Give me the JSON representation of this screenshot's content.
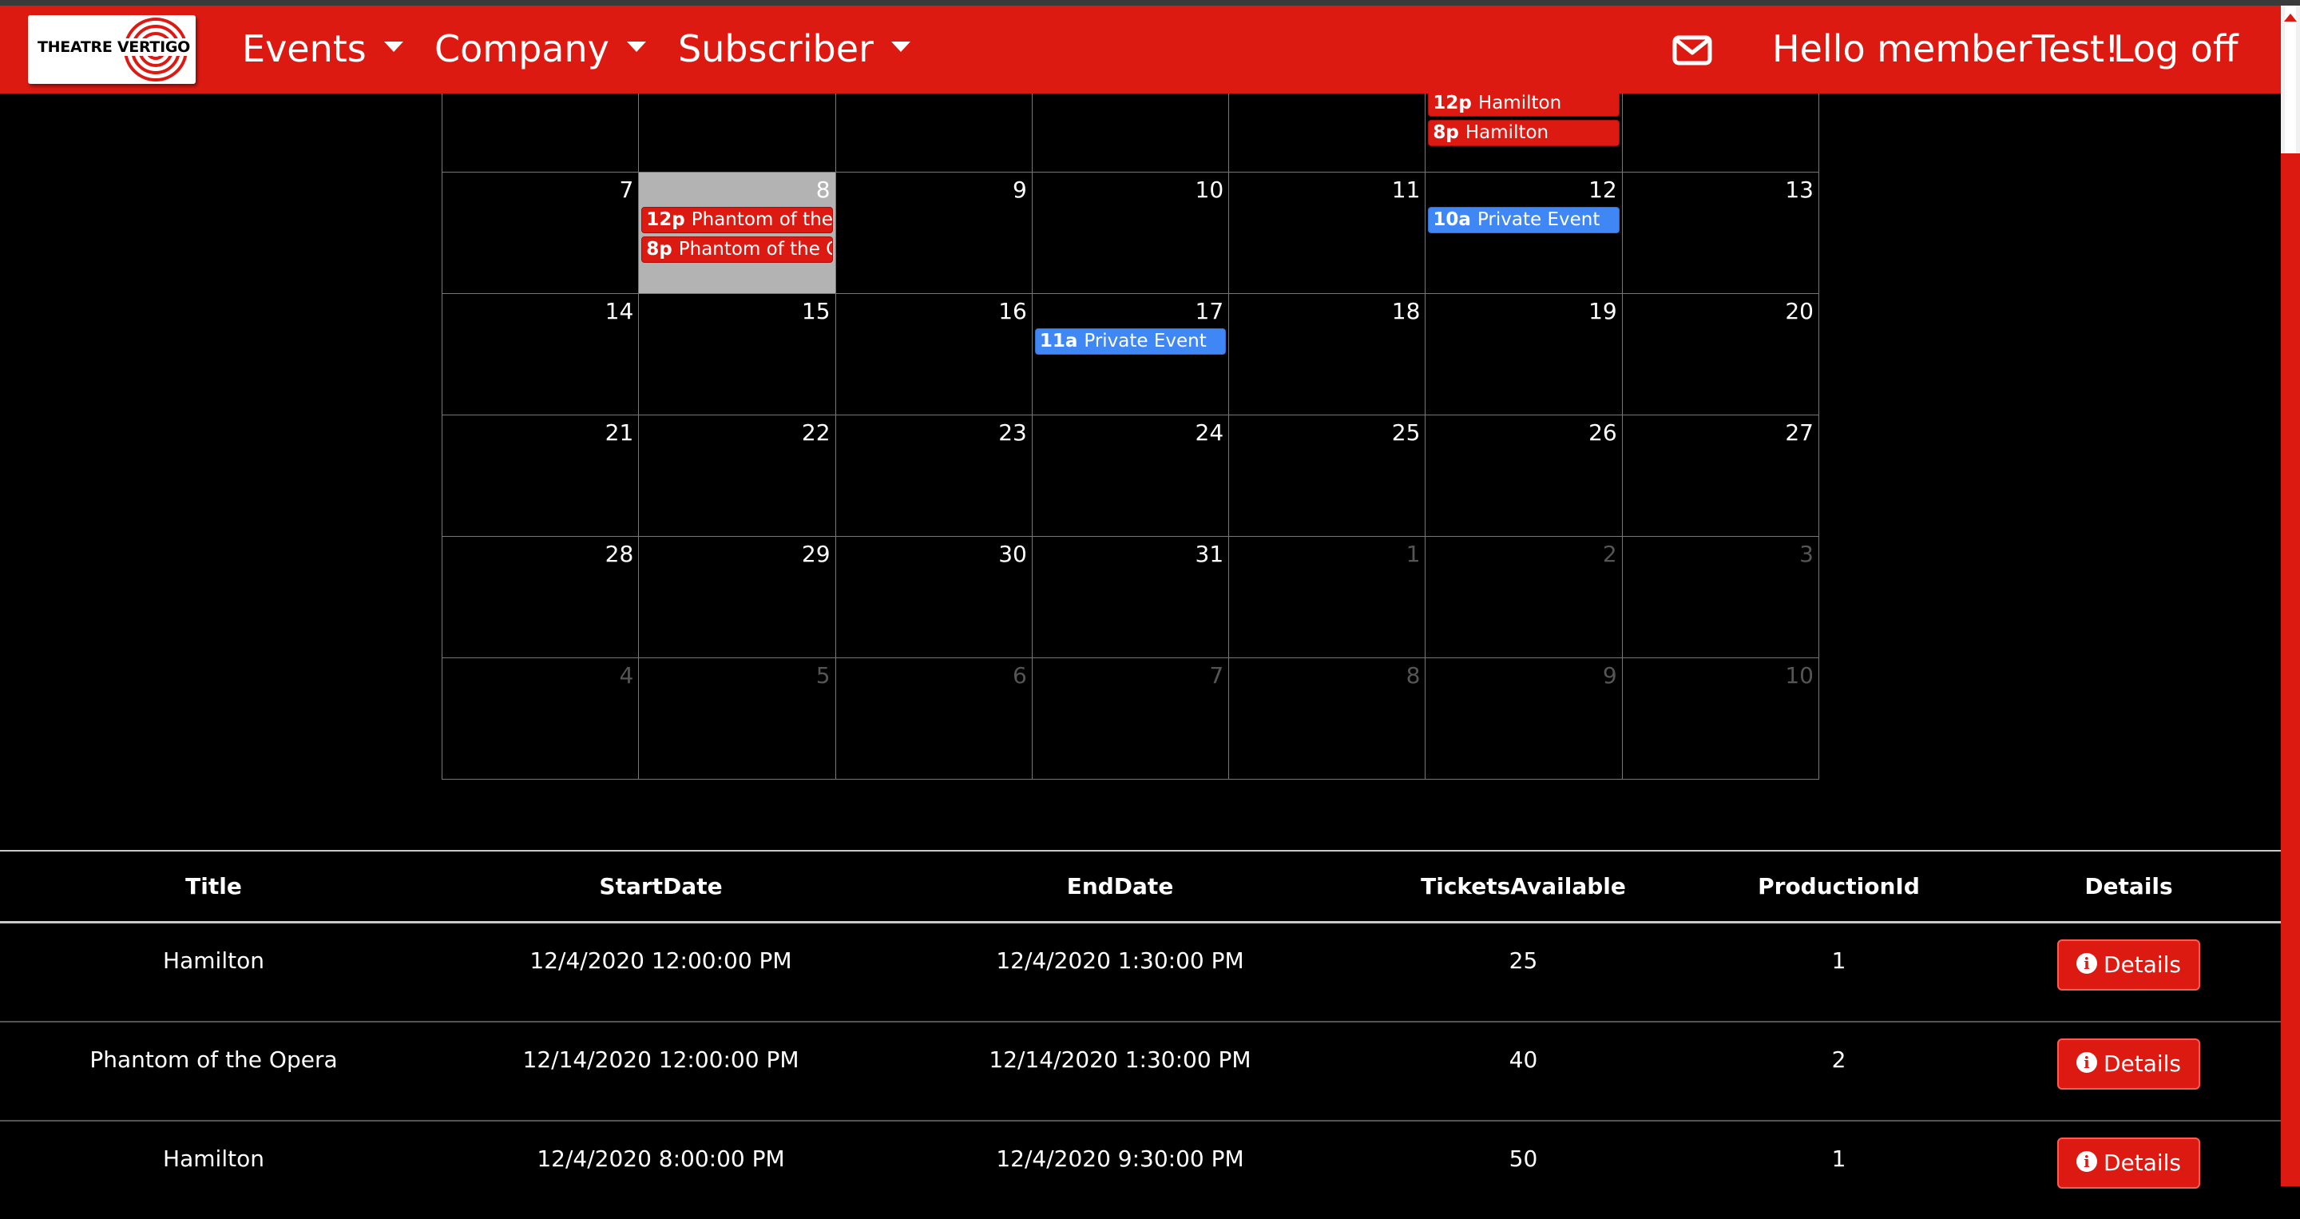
{
  "logo": {
    "text": "THEATRE VERTIGO"
  },
  "nav": {
    "events": "Events",
    "company": "Company",
    "subscriber": "Subscriber",
    "greeting": "Hello memberTest!",
    "logoff": "Log off"
  },
  "calendar": {
    "weeks": [
      [
        {
          "day": "",
          "other": false,
          "today": false,
          "events": []
        },
        {
          "day": "",
          "other": false,
          "today": false,
          "events": []
        },
        {
          "day": "",
          "other": false,
          "today": false,
          "events": []
        },
        {
          "day": "",
          "other": false,
          "today": false,
          "events": []
        },
        {
          "day": "",
          "other": false,
          "today": false,
          "events": []
        },
        {
          "day": "",
          "other": false,
          "today": false,
          "events": [
            {
              "time": "12p",
              "title": "Hamilton",
              "color": "red"
            },
            {
              "time": "8p",
              "title": "Hamilton",
              "color": "red"
            }
          ]
        },
        {
          "day": "",
          "other": false,
          "today": false,
          "events": []
        }
      ],
      [
        {
          "day": "7",
          "other": false,
          "today": false,
          "events": []
        },
        {
          "day": "8",
          "other": false,
          "today": true,
          "events": [
            {
              "time": "12p",
              "title": "Phantom of the Opera",
              "color": "red"
            },
            {
              "time": "8p",
              "title": "Phantom of the Opera",
              "color": "red"
            }
          ]
        },
        {
          "day": "9",
          "other": false,
          "today": false,
          "events": []
        },
        {
          "day": "10",
          "other": false,
          "today": false,
          "events": []
        },
        {
          "day": "11",
          "other": false,
          "today": false,
          "events": []
        },
        {
          "day": "12",
          "other": false,
          "today": false,
          "events": [
            {
              "time": "10a",
              "title": "Private Event",
              "color": "blue"
            }
          ]
        },
        {
          "day": "13",
          "other": false,
          "today": false,
          "events": []
        }
      ],
      [
        {
          "day": "14",
          "other": false,
          "today": false,
          "events": []
        },
        {
          "day": "15",
          "other": false,
          "today": false,
          "events": []
        },
        {
          "day": "16",
          "other": false,
          "today": false,
          "events": []
        },
        {
          "day": "17",
          "other": false,
          "today": false,
          "events": [
            {
              "time": "11a",
              "title": "Private Event",
              "color": "blue"
            }
          ]
        },
        {
          "day": "18",
          "other": false,
          "today": false,
          "events": []
        },
        {
          "day": "19",
          "other": false,
          "today": false,
          "events": []
        },
        {
          "day": "20",
          "other": false,
          "today": false,
          "events": []
        }
      ],
      [
        {
          "day": "21",
          "other": false,
          "today": false,
          "events": []
        },
        {
          "day": "22",
          "other": false,
          "today": false,
          "events": []
        },
        {
          "day": "23",
          "other": false,
          "today": false,
          "events": []
        },
        {
          "day": "24",
          "other": false,
          "today": false,
          "events": []
        },
        {
          "day": "25",
          "other": false,
          "today": false,
          "events": []
        },
        {
          "day": "26",
          "other": false,
          "today": false,
          "events": []
        },
        {
          "day": "27",
          "other": false,
          "today": false,
          "events": []
        }
      ],
      [
        {
          "day": "28",
          "other": false,
          "today": false,
          "events": []
        },
        {
          "day": "29",
          "other": false,
          "today": false,
          "events": []
        },
        {
          "day": "30",
          "other": false,
          "today": false,
          "events": []
        },
        {
          "day": "31",
          "other": false,
          "today": false,
          "events": []
        },
        {
          "day": "1",
          "other": true,
          "today": false,
          "events": []
        },
        {
          "day": "2",
          "other": true,
          "today": false,
          "events": []
        },
        {
          "day": "3",
          "other": true,
          "today": false,
          "events": []
        }
      ],
      [
        {
          "day": "4",
          "other": true,
          "today": false,
          "events": []
        },
        {
          "day": "5",
          "other": true,
          "today": false,
          "events": []
        },
        {
          "day": "6",
          "other": true,
          "today": false,
          "events": []
        },
        {
          "day": "7",
          "other": true,
          "today": false,
          "events": []
        },
        {
          "day": "8",
          "other": true,
          "today": false,
          "events": []
        },
        {
          "day": "9",
          "other": true,
          "today": false,
          "events": []
        },
        {
          "day": "10",
          "other": true,
          "today": false,
          "events": []
        }
      ]
    ]
  },
  "table": {
    "headers": [
      "Title",
      "StartDate",
      "EndDate",
      "TicketsAvailable",
      "ProductionId",
      "Details"
    ],
    "rows": [
      {
        "title": "Hamilton",
        "start": "12/4/2020 12:00:00 PM",
        "end": "12/4/2020 1:30:00 PM",
        "tickets": "25",
        "production": "1",
        "details": "Details"
      },
      {
        "title": "Phantom of the Opera",
        "start": "12/14/2020 12:00:00 PM",
        "end": "12/14/2020 1:30:00 PM",
        "tickets": "40",
        "production": "2",
        "details": "Details"
      },
      {
        "title": "Hamilton",
        "start": "12/4/2020 8:00:00 PM",
        "end": "12/4/2020 9:30:00 PM",
        "tickets": "50",
        "production": "1",
        "details": "Details"
      }
    ]
  },
  "colors": {
    "brand": "#dd1a12",
    "event_red": "#dd1a12",
    "event_blue": "#3f87f5",
    "today": "#b3b3b3"
  }
}
